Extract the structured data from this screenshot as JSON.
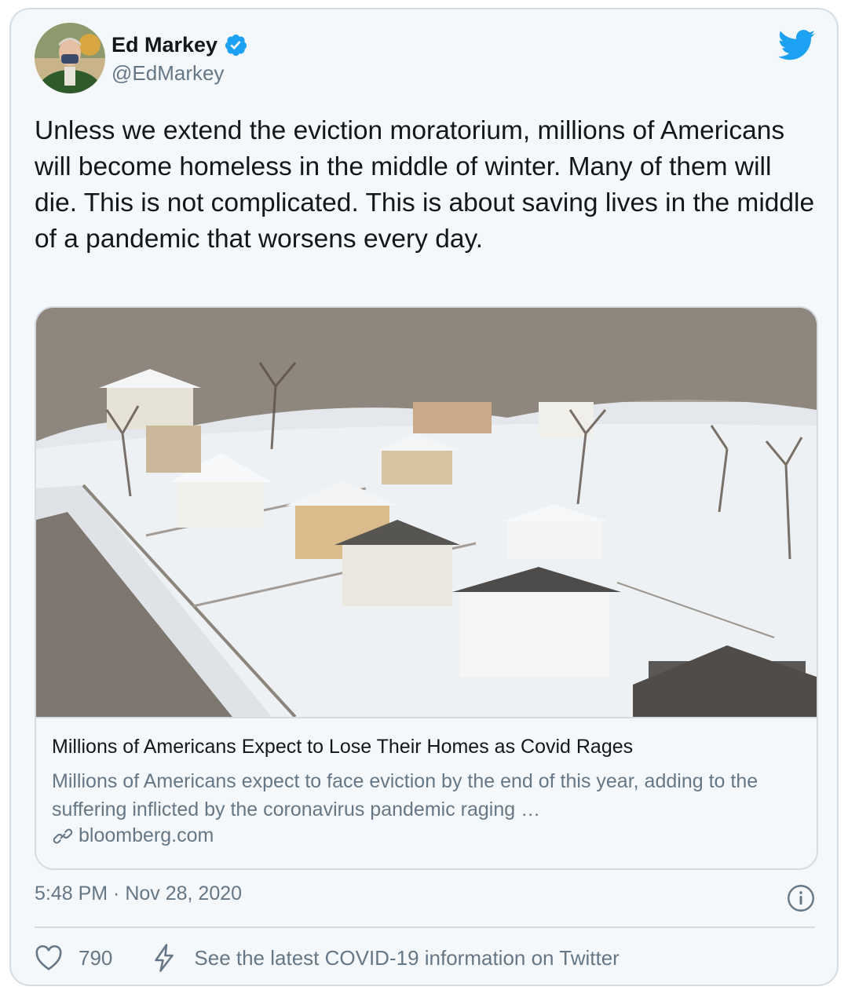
{
  "author": {
    "name": "Ed Markey",
    "handle": "@EdMarkey",
    "verified": true,
    "avatar": "profile-photo"
  },
  "tweet": {
    "text": "Unless we extend the eviction moratorium, millions of Americans will become homeless in the middle of winter. Many of them will die. This is not complicated. This is about saving lives in the middle of a pandemic that worsens every day."
  },
  "link_card": {
    "image": "aerial-snowy-neighborhood-photo",
    "title": "Millions of Americans Expect to Lose Their Homes as Covid Rages",
    "description": "Millions of Americans expect to face eviction by the end of this year, adding to the suffering inflicted by the coronavirus pandemic raging …",
    "domain": "bloomberg.com",
    "domain_icon": "link-icon"
  },
  "meta": {
    "timestamp": "5:48 PM · Nov 28, 2020"
  },
  "actions": {
    "like_count": "790",
    "covid_info": "See the latest COVID-19 information on Twitter"
  },
  "icons": {
    "brand": "twitter-bird-icon",
    "verified": "verified-badge-icon",
    "info": "info-icon",
    "like": "heart-icon",
    "covid": "lightning-bolt-icon"
  },
  "colors": {
    "accent": "#1da1f2",
    "text": "#14171a",
    "secondary_text": "#657786",
    "border": "#d4dbe2",
    "background": "#f5f8fa"
  }
}
